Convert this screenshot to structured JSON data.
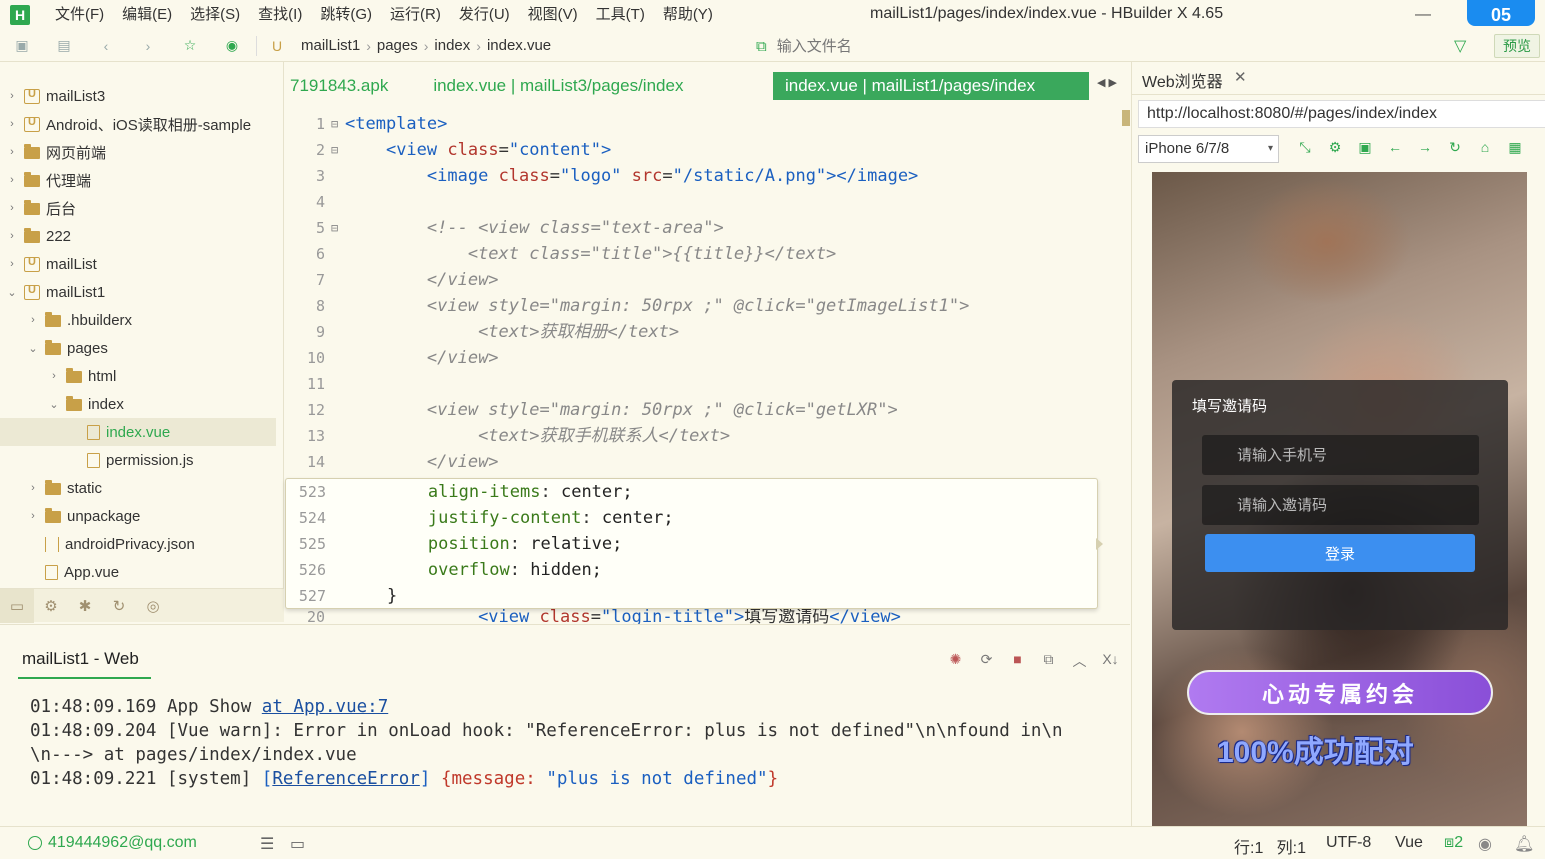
{
  "menu": {
    "items": [
      "文件(F)",
      "编辑(E)",
      "选择(S)",
      "查找(I)",
      "跳转(G)",
      "运行(R)",
      "发行(U)",
      "视图(V)",
      "工具(T)",
      "帮助(Y)"
    ],
    "window_title": "mailList1/pages/index/index.vue - HBuilder X 4.65"
  },
  "toolbar": {
    "breadcrumb": [
      "mailList1",
      "pages",
      "index",
      "index.vue"
    ],
    "file_search_placeholder": "输入文件名",
    "preview_label": "预览"
  },
  "sidebar": {
    "items": [
      {
        "label": "mailList3",
        "type": "proj",
        "indent": 0,
        "chev": "›"
      },
      {
        "label": "Android、iOS读取相册-sample",
        "type": "proj",
        "indent": 0,
        "chev": "›"
      },
      {
        "label": "网页前端",
        "type": "folder",
        "indent": 0,
        "chev": "›"
      },
      {
        "label": "代理端",
        "type": "folder",
        "indent": 0,
        "chev": "›"
      },
      {
        "label": "后台",
        "type": "folder",
        "indent": 0,
        "chev": "›"
      },
      {
        "label": "222",
        "type": "folder",
        "indent": 0,
        "chev": "›"
      },
      {
        "label": "mailList",
        "type": "proj",
        "indent": 0,
        "chev": "›"
      },
      {
        "label": "mailList1",
        "type": "proj",
        "indent": 0,
        "chev": "⌄"
      },
      {
        "label": ".hbuilderx",
        "type": "folder",
        "indent": 1,
        "chev": "›"
      },
      {
        "label": "pages",
        "type": "folder",
        "indent": 1,
        "chev": "⌄"
      },
      {
        "label": "html",
        "type": "folder",
        "indent": 2,
        "chev": "›"
      },
      {
        "label": "index",
        "type": "folder",
        "indent": 2,
        "chev": "⌄"
      },
      {
        "label": "index.vue",
        "type": "file",
        "indent": 3,
        "chev": ""
      },
      {
        "label": "permission.js",
        "type": "file",
        "indent": 3,
        "chev": ""
      },
      {
        "label": "static",
        "type": "folder",
        "indent": 1,
        "chev": "›"
      },
      {
        "label": "unpackage",
        "type": "folder",
        "indent": 1,
        "chev": "›"
      },
      {
        "label": "androidPrivacy.json",
        "type": "json",
        "indent": 1,
        "chev": ""
      },
      {
        "label": "App.vue",
        "type": "file",
        "indent": 1,
        "chev": ""
      }
    ],
    "selected": "index.vue"
  },
  "editor": {
    "tabs": [
      "7191843.apk",
      "index.vue | mailList3/pages/index",
      "index.vue | mailList1/pages/index"
    ],
    "active_tab": "index.vue | mailList1/pages/index",
    "lines": [
      {
        "n": "1",
        "fold": "⊟",
        "html": "<span class='tag'>&lt;template&gt;</span>"
      },
      {
        "n": "2",
        "fold": "⊟",
        "html": "    <span class='tag'>&lt;view</span> <span class='attr'>class</span>=<span class='str'>\"content\"</span><span class='tag'>&gt;</span>"
      },
      {
        "n": "3",
        "fold": "",
        "html": "        <span class='tag'>&lt;image</span> <span class='attr'>class</span>=<span class='str'>\"logo\"</span> <span class='attr'>src</span>=<span class='str'>\"/static/A.png\"</span><span class='tag'>&gt;&lt;/image&gt;</span>"
      },
      {
        "n": "4",
        "fold": "",
        "html": ""
      },
      {
        "n": "5",
        "fold": "⊟",
        "html": "        <span class='cmt'>&lt;!-- &lt;view class=\"text-area\"&gt;</span>"
      },
      {
        "n": "6",
        "fold": "",
        "html": "            <span class='cmt'>&lt;text class=\"title\"&gt;{{title}}&lt;/text&gt;</span>"
      },
      {
        "n": "7",
        "fold": "",
        "html": "        <span class='cmt'>&lt;/view&gt;</span>"
      },
      {
        "n": "8",
        "fold": "",
        "html": "        <span class='cmt'>&lt;view style=\"margin: 50rpx ;\" @click=\"getImageList1\"&gt;</span>"
      },
      {
        "n": "9",
        "fold": "",
        "html": "             <span class='cmt'>&lt;text&gt;获取相册&lt;/text&gt;</span>"
      },
      {
        "n": "10",
        "fold": "",
        "html": "        <span class='cmt'>&lt;/view&gt;</span>"
      },
      {
        "n": "11",
        "fold": "",
        "html": ""
      },
      {
        "n": "12",
        "fold": "",
        "html": "        <span class='cmt'>&lt;view style=\"margin: 50rpx ;\" @click=\"getLXR\"&gt;</span>"
      },
      {
        "n": "13",
        "fold": "",
        "html": "             <span class='cmt'>&lt;text&gt;获取手机联系人&lt;/text&gt;</span>"
      },
      {
        "n": "14",
        "fold": "",
        "html": "        <span class='cmt'>&lt;/view&gt;</span>"
      }
    ],
    "bottom_line": {
      "n": "20",
      "html": "             <span class='tag'>&lt;view</span> <span class='attr'>class</span>=<span class='str'>\"login-title\"</span><span class='tag'>&gt;</span>填写邀请码<span class='tag'>&lt;/view&gt;</span>"
    },
    "peek_lines": [
      {
        "n": "523",
        "html": "        <span class='prop'>align-items</span>: <span class='val'>center;</span>"
      },
      {
        "n": "524",
        "html": "        <span class='prop'>justify-content</span>: <span class='val'>center;</span>"
      },
      {
        "n": "525",
        "html": "        <span class='prop'>position</span>: <span class='val'>relative;</span>"
      },
      {
        "n": "526",
        "html": "        <span class='prop'>overflow</span>: <span class='val'>hidden;</span>"
      },
      {
        "n": "527",
        "html": "    <span class='val'>}</span>"
      }
    ]
  },
  "console": {
    "tab_label": "mailList1 - Web",
    "lines": [
      "01:48:09.169 App Show <span class='lnk'>at App.vue:7</span>",
      "01:48:09.204 [Vue warn]: Error in onLoad hook: \"ReferenceError: plus is not defined\"\\n\\nfound in\\n",
      "\\n---> at pages/index/index.vue",
      "01:48:09.221 [system] <span class='blue'>[</span><span class='lnk'>ReferenceError</span><span class='blue'>]</span> <span class='red'>{message: </span><span class='blue'>\"plus is not defined\"</span><span class='red'>}</span>"
    ]
  },
  "statusbar": {
    "user": "419444962@qq.com",
    "position": "行:1   列:1",
    "encoding": "UTF-8",
    "language": "Vue",
    "count": "2"
  },
  "browser": {
    "tab_label": "Web浏览器",
    "url": "http://localhost:8080/#/pages/index/index",
    "device": "iPhone 6/7/8",
    "invite_title": "填写邀请码",
    "phone_placeholder": "请输入手机号",
    "code_placeholder": "请输入邀请码",
    "login_label": "登录",
    "promo_button": "心动专属约会",
    "promo_text": "100%成功配对"
  },
  "colors": {
    "accent": "#2fa84f",
    "active_tab": "#3aa85c",
    "login_button": "#3c8ff0"
  }
}
